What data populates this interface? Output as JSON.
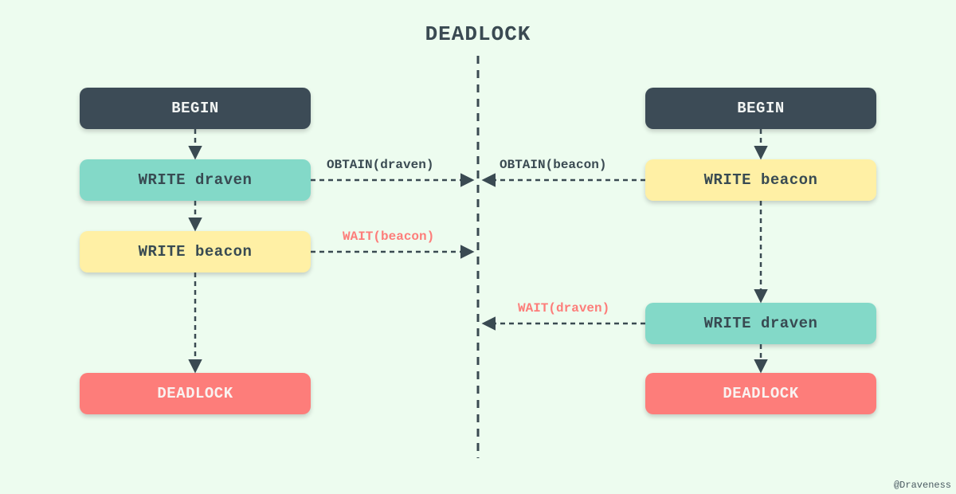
{
  "title": "DEADLOCK",
  "credit": "@Draveness",
  "left": {
    "begin": "BEGIN",
    "step1": "WRITE draven",
    "step2": "WRITE beacon",
    "final": "DEADLOCK"
  },
  "right": {
    "begin": "BEGIN",
    "step1": "WRITE beacon",
    "step2": "WRITE draven",
    "final": "DEADLOCK"
  },
  "edges": {
    "obtain_left": "OBTAIN(draven)",
    "obtain_right": "OBTAIN(beacon)",
    "wait_left": "WAIT(beacon)",
    "wait_right": "WAIT(draven)"
  }
}
